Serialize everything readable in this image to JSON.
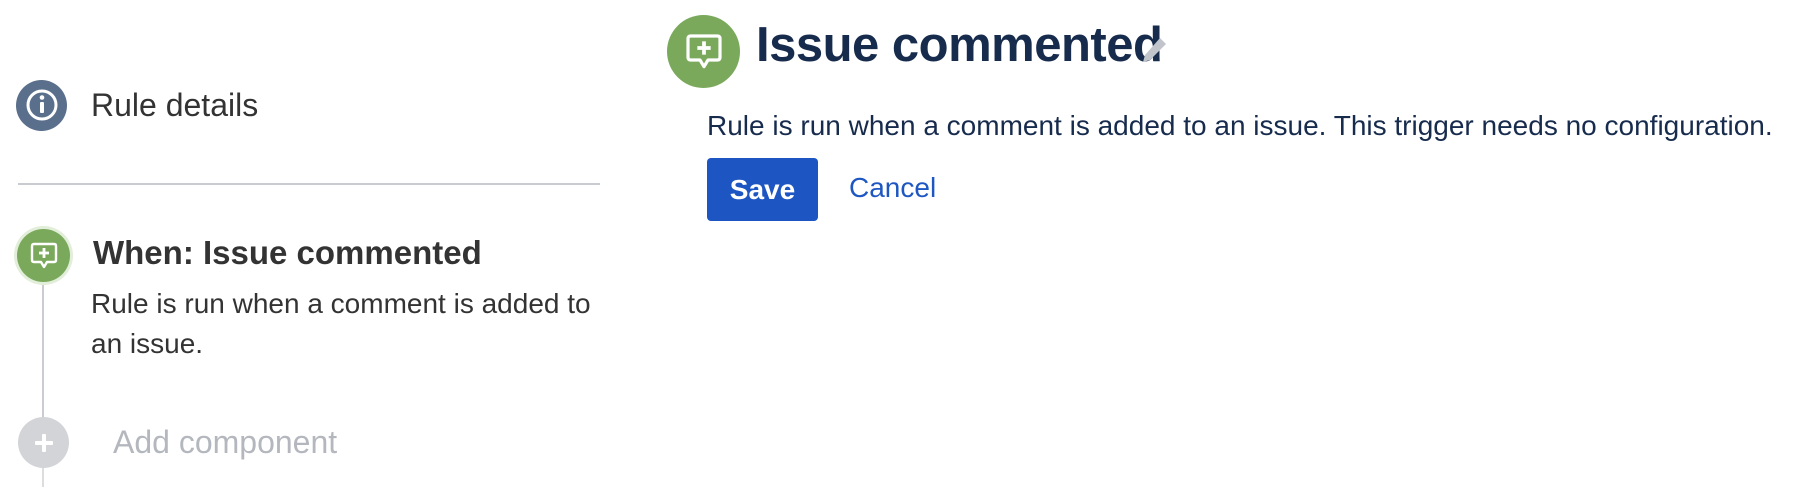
{
  "sidebar": {
    "rule_details": {
      "icon": "info-icon",
      "label": "Rule details"
    },
    "trigger": {
      "icon": "comment-add-icon",
      "title": "When: Issue commented",
      "description": "Rule is run when a comment is added to an issue."
    },
    "add_component": {
      "icon": "plus-icon",
      "label": "Add component"
    }
  },
  "panel": {
    "icon": "comment-add-icon",
    "title": "Issue commented",
    "edit_icon": "pencil-icon",
    "description": "Rule is run when a comment is added to an issue. This trigger needs no configuration.",
    "save_label": "Save",
    "cancel_label": "Cancel"
  },
  "colors": {
    "trigger_green": "#7aa95c",
    "info_slate": "#5a6f8c",
    "primary_blue": "#1d56c2",
    "link_blue": "#1f57c2",
    "muted_grey": "#b4b8be",
    "heading_navy": "#172b4d"
  }
}
